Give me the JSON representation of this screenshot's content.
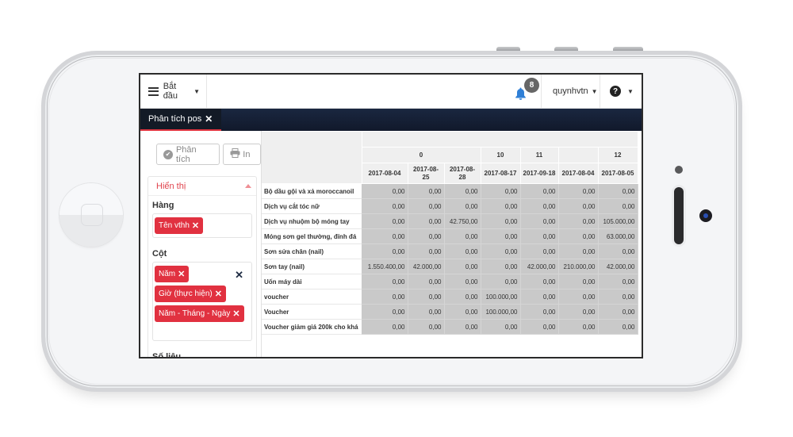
{
  "topbar": {
    "start_label": "Bắt đầu",
    "notification_count": "8",
    "username": "quynhvtn",
    "help_icon": "question-circle-icon"
  },
  "tabs": [
    {
      "label": "Phân tích pos",
      "active": true
    }
  ],
  "sidebar": {
    "analyze_button": "Phân tích",
    "print_button": "In",
    "panel_title": "Hiển thị",
    "rows_label": "Hàng",
    "rows_pills": [
      "Tên vthh"
    ],
    "columns_label": "Cột",
    "columns_pills": [
      "Năm",
      "Giờ (thực hiện)",
      "Năm - Tháng - Ngày"
    ],
    "next_section_label": "Số liệu"
  },
  "pivot": {
    "column_groups": [
      {
        "label": "0",
        "span": 3
      },
      {
        "label": "10",
        "span": 1
      },
      {
        "label": "11",
        "span": 1
      },
      {
        "label": "",
        "span": 1
      },
      {
        "label": "12",
        "span": 1
      }
    ],
    "dates": [
      "2017-08-04",
      "2017-08-25",
      "2017-08-28",
      "2017-08-17",
      "2017-09-18",
      "2017-08-04",
      "2017-08-05"
    ],
    "rows": [
      {
        "label": "Bộ dầu gội và xả moroccanoil",
        "values": [
          "0,00",
          "0,00",
          "0,00",
          "0,00",
          "0,00",
          "0,00",
          "0,00"
        ]
      },
      {
        "label": "Dịch vụ cắt tóc nữ",
        "values": [
          "0,00",
          "0,00",
          "0,00",
          "0,00",
          "0,00",
          "0,00",
          "0,00"
        ]
      },
      {
        "label": "Dịch vụ nhuộm bộ móng tay",
        "values": [
          "0,00",
          "0,00",
          "42.750,00",
          "0,00",
          "0,00",
          "0,00",
          "105.000,00"
        ]
      },
      {
        "label": "Móng sơn gel thường, đính đá",
        "values": [
          "0,00",
          "0,00",
          "0,00",
          "0,00",
          "0,00",
          "0,00",
          "63.000,00"
        ]
      },
      {
        "label": "Sơn sửa chân (nail)",
        "values": [
          "0,00",
          "0,00",
          "0,00",
          "0,00",
          "0,00",
          "0,00",
          "0,00"
        ]
      },
      {
        "label": "Sơn tay (nail)",
        "values": [
          "1.550.400,00",
          "42.000,00",
          "0,00",
          "0,00",
          "42.000,00",
          "210.000,00",
          "42.000,00"
        ]
      },
      {
        "label": "Uốn máy dài",
        "values": [
          "0,00",
          "0,00",
          "0,00",
          "0,00",
          "0,00",
          "0,00",
          "0,00"
        ]
      },
      {
        "label": "voucher",
        "values": [
          "0,00",
          "0,00",
          "0,00",
          "100.000,00",
          "0,00",
          "0,00",
          "0,00"
        ]
      },
      {
        "label": "Voucher",
        "values": [
          "0,00",
          "0,00",
          "0,00",
          "100.000,00",
          "0,00",
          "0,00",
          "0,00"
        ]
      },
      {
        "label": "Voucher giảm giá 200k cho khá",
        "values": [
          "0,00",
          "0,00",
          "0,00",
          "0,00",
          "0,00",
          "0,00",
          "0,00"
        ]
      }
    ]
  },
  "colors": {
    "accent_red": "#e13140",
    "nav_dark": "#131a26",
    "bell_blue": "#2f7fd6"
  }
}
